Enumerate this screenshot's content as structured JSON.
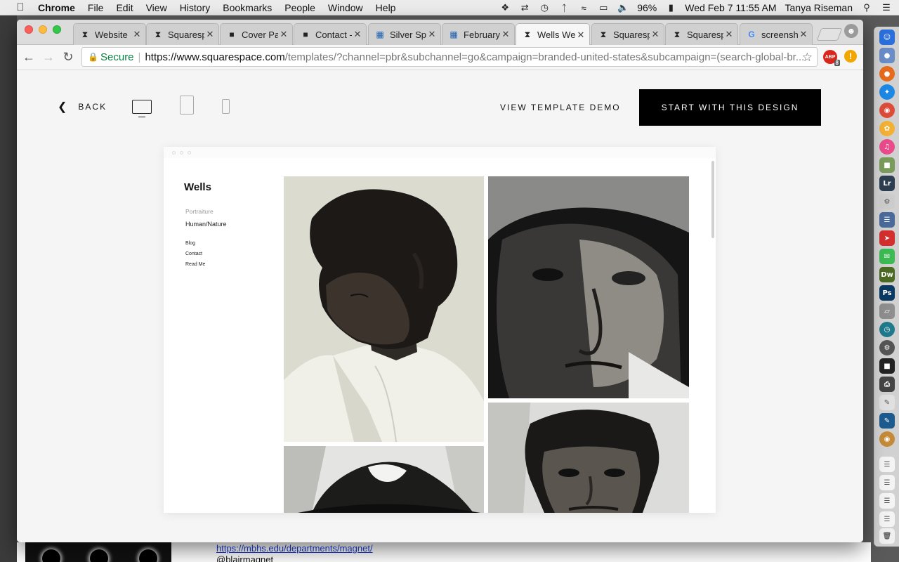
{
  "menubar": {
    "app_name": "Chrome",
    "menus": [
      "File",
      "Edit",
      "View",
      "History",
      "Bookmarks",
      "People",
      "Window",
      "Help"
    ],
    "battery": "96%",
    "datetime": "Wed Feb 7  11:55 AM",
    "user": "Tanya Riseman"
  },
  "tabs": [
    {
      "label": "Website",
      "icon": "squarespace-icon"
    },
    {
      "label": "Squaresp",
      "icon": "squarespace-icon"
    },
    {
      "label": "Cover Pa",
      "icon": "cube-icon"
    },
    {
      "label": "Contact -",
      "icon": "cube-icon"
    },
    {
      "label": "Silver Sp",
      "icon": "calendar-icon"
    },
    {
      "label": "February",
      "icon": "calendar-icon"
    },
    {
      "label": "Wells We",
      "icon": "squarespace-icon",
      "active": true
    },
    {
      "label": "Squaresp",
      "icon": "squarespace-icon"
    },
    {
      "label": "Squaresp",
      "icon": "squarespace-icon"
    },
    {
      "label": "screensh",
      "icon": "google-icon"
    }
  ],
  "address_bar": {
    "secure_label": "Secure",
    "url_host": "https://www.squarespace.com",
    "url_rest": "/templates/?channel=pbr&subchannel=go&campaign=branded-united-states&subcampaign=(search-global-br..."
  },
  "extensions": {
    "adblock_badge": "8",
    "adblock_text": "ABP"
  },
  "header": {
    "back_label": "BACK",
    "demo_label": "VIEW TEMPLATE DEMO",
    "start_label": "START WITH THIS DESIGN"
  },
  "template_preview": {
    "site_title": "Wells",
    "nav_primary": [
      "Portraiture",
      "Human/Nature"
    ],
    "nav_secondary": [
      "Blog",
      "Contact",
      "Read Me"
    ]
  },
  "background_page": {
    "link": "https://mbhs.edu/departments/magnet/",
    "handle": "@blairmagnet"
  },
  "colors": {
    "start_button_bg": "#000000",
    "secure_green": "#0b8043",
    "page_bg": "#f5f5f5"
  }
}
